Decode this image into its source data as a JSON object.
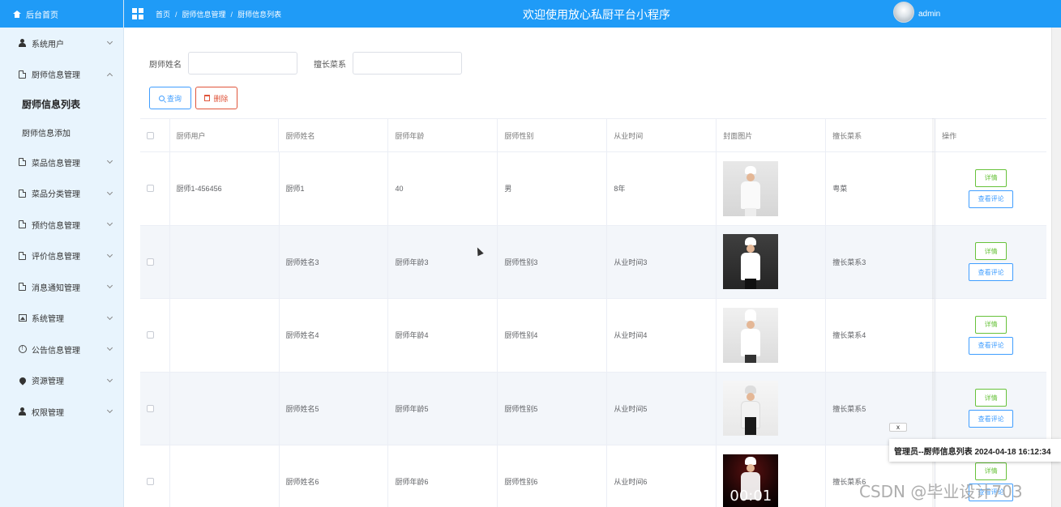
{
  "sidebar": {
    "home_label": "后台首页",
    "menus": [
      {
        "label": "系统用户",
        "icon": "user-icon",
        "expanded": false
      },
      {
        "label": "厨师信息管理",
        "icon": "document-icon",
        "expanded": true,
        "children": [
          {
            "label": "厨师信息列表",
            "active": true
          },
          {
            "label": "厨师信息添加",
            "active": false
          }
        ]
      },
      {
        "label": "菜品信息管理",
        "icon": "document-icon",
        "expanded": false
      },
      {
        "label": "菜品分类管理",
        "icon": "document-icon",
        "expanded": false
      },
      {
        "label": "预约信息管理",
        "icon": "document-icon",
        "expanded": false
      },
      {
        "label": "评价信息管理",
        "icon": "document-icon",
        "expanded": false
      },
      {
        "label": "消息通知管理",
        "icon": "document-icon",
        "expanded": false
      },
      {
        "label": "系统管理",
        "icon": "picture-icon",
        "expanded": false
      },
      {
        "label": "公告信息管理",
        "icon": "info-icon",
        "expanded": false
      },
      {
        "label": "资源管理",
        "icon": "location-icon",
        "expanded": false
      },
      {
        "label": "权限管理",
        "icon": "user-icon",
        "expanded": false
      }
    ]
  },
  "header": {
    "breadcrumbs": [
      "首页",
      "厨师信息管理",
      "厨师信息列表"
    ],
    "title": "欢迎使用放心私厨平台小程序",
    "username": "admin"
  },
  "search": {
    "name_label": "厨师姓名",
    "name_value": "",
    "dish_label": "擅长菜系",
    "dish_value": "",
    "query_label": "查询",
    "delete_label": "删除"
  },
  "table": {
    "columns": [
      "厨师用户",
      "厨师姓名",
      "厨师年龄",
      "厨师性别",
      "从业时间",
      "封面图片",
      "擅长菜系",
      "操作"
    ],
    "rows": [
      {
        "user": "厨师1-456456",
        "name": "厨师1",
        "age": "40",
        "gender": "男",
        "years": "8年",
        "dish": "粤菜"
      },
      {
        "user": "",
        "name": "厨师姓名3",
        "age": "厨师年龄3",
        "gender": "厨师性别3",
        "years": "从业时间3",
        "dish": "擅长菜系3"
      },
      {
        "user": "",
        "name": "厨师姓名4",
        "age": "厨师年龄4",
        "gender": "厨师性别4",
        "years": "从业时间4",
        "dish": "擅长菜系4"
      },
      {
        "user": "",
        "name": "厨师姓名5",
        "age": "厨师年龄5",
        "gender": "厨师性别5",
        "years": "从业时间5",
        "dish": "擅长菜系5"
      },
      {
        "user": "",
        "name": "厨师姓名6",
        "age": "厨师年龄6",
        "gender": "厨师性别6",
        "years": "从业时间6",
        "dish": "擅长菜系6",
        "photo_overlay": "00:01"
      }
    ],
    "detail_label": "详情",
    "comment_label": "查看评论"
  },
  "toast": {
    "close_label": "x",
    "text": "管理员--厨师信息列表 2024-04-18 16:12:34"
  },
  "watermark": "CSDN @毕业设计703",
  "colors": {
    "primary": "#1f9bf7",
    "sidebar_bg": "#e8f4fd",
    "success": "#67c23a",
    "danger": "#e0553b",
    "link": "#409eff"
  }
}
